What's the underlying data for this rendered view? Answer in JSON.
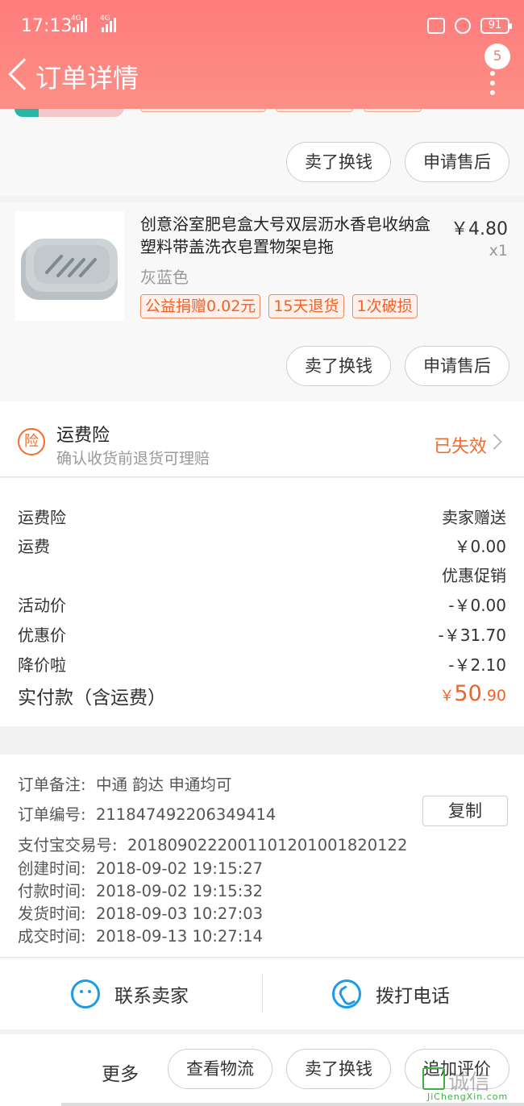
{
  "status_bar": {
    "time": "17:13",
    "network_1": "4G",
    "network_2": "4G",
    "battery": "91"
  },
  "header": {
    "title": "订单详情",
    "badge_count": "5"
  },
  "item1": {
    "actions": [
      "卖了换钱",
      "申请售后"
    ]
  },
  "item2": {
    "name": "创意浴室肥皂盒大号双层沥水香皂收纳盒塑料带盖洗衣皂置物架皂拖",
    "price": "￥4.80",
    "qty": "x1",
    "spec": "灰蓝色",
    "tags": [
      "公益捐赠0.02元",
      "15天退货",
      "1次破损"
    ],
    "actions": [
      "卖了换钱",
      "申请售后"
    ]
  },
  "insurance": {
    "icon_char": "险",
    "title": "运费险",
    "subtitle": "确认收货前退货可理赔",
    "status": "已失效"
  },
  "summary": {
    "rows": [
      {
        "label": "运费险",
        "value": "卖家赠送"
      },
      {
        "label": "运费",
        "value": "￥0.00"
      },
      {
        "label": "",
        "value": "优惠促销"
      },
      {
        "label": "活动价",
        "value": "-￥0.00"
      },
      {
        "label": "优惠价",
        "value": "-￥31.70"
      },
      {
        "label": "降价啦",
        "value": "-￥2.10"
      }
    ],
    "total_label": "实付款（含运费）",
    "total_currency": "￥",
    "total_int": "50",
    "total_dec": ".90"
  },
  "order_info": {
    "rows": [
      {
        "key": "订单备注:",
        "value": "中通 韵达 申通均可"
      },
      {
        "key": "订单编号:",
        "value": "211847492206349414"
      },
      {
        "key": "支付宝交易号:",
        "value": "2018090222001101201001820122"
      },
      {
        "key": "创建时间:",
        "value": "2018-09-02 19:15:27"
      },
      {
        "key": "付款时间:",
        "value": "2018-09-02 19:15:32"
      },
      {
        "key": "发货时间:",
        "value": "2018-09-03 10:27:03"
      },
      {
        "key": "成交时间:",
        "value": "2018-09-13 10:27:14"
      }
    ],
    "copy_label": "复制"
  },
  "contact": {
    "seller_label": "联系卖家",
    "phone_label": "拨打电话"
  },
  "bottom_bar": {
    "more_label": "更多",
    "buttons": [
      "查看物流",
      "卖了换钱",
      "追加评价"
    ]
  },
  "watermark": {
    "text": "诚信",
    "sub": "JiChengXin.com"
  }
}
